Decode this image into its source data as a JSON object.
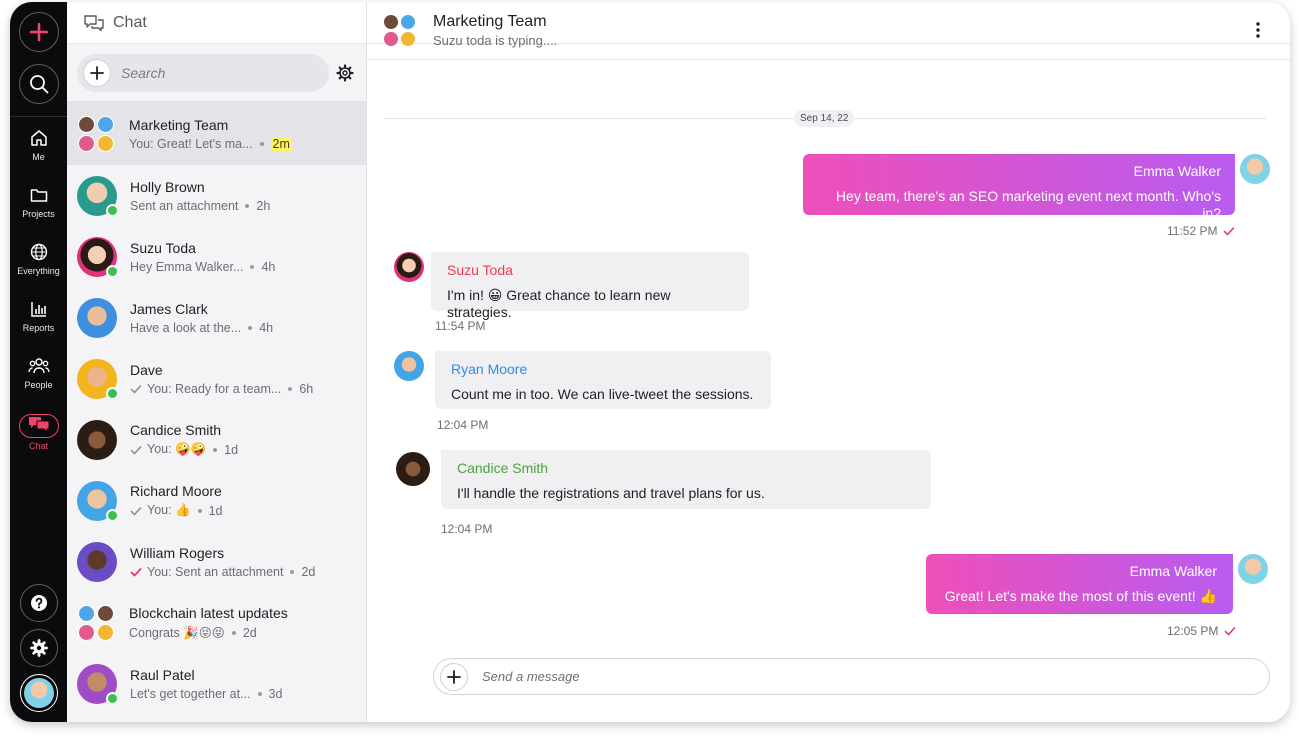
{
  "app": {
    "title": "Chat"
  },
  "rail": {
    "items": [
      {
        "label": "Me",
        "icon": "home-icon"
      },
      {
        "label": "Projects",
        "icon": "folder-icon"
      },
      {
        "label": "Everything",
        "icon": "globe-icon"
      },
      {
        "label": "Reports",
        "icon": "bar-chart-icon"
      },
      {
        "label": "People",
        "icon": "people-icon"
      },
      {
        "label": "Chat",
        "icon": "chat-icon",
        "active": true
      }
    ],
    "accent": "#f0446e"
  },
  "search": {
    "placeholder": "Search"
  },
  "conversations": [
    {
      "name": "Marketing Team",
      "preview": "You: Great! Let's ma...",
      "time": "2m",
      "group": true,
      "active": true
    },
    {
      "name": "Holly Brown",
      "preview": "Sent an attachment",
      "time": "2h",
      "online": true
    },
    {
      "name": "Suzu Toda",
      "preview": "Hey Emma Walker...",
      "time": "4h",
      "online": true
    },
    {
      "name": "James Clark",
      "preview": "Have a look at the...",
      "time": "4h"
    },
    {
      "name": "Dave",
      "preview": "You: Ready for a team...",
      "time": "6h",
      "online": true,
      "check": "grey"
    },
    {
      "name": "Candice Smith",
      "preview": "You: 🤪🤪",
      "time": "1d",
      "check": "grey"
    },
    {
      "name": "Richard Moore",
      "preview": "You: 👍",
      "time": "1d",
      "online": true,
      "check": "grey"
    },
    {
      "name": "William Rogers",
      "preview": "You: Sent an attachment",
      "time": "2d",
      "check": "pink"
    },
    {
      "name": "Blockchain latest updates",
      "preview": "Congrats 🎉😝😝",
      "time": "2d",
      "group": true
    },
    {
      "name": "Raul Patel",
      "preview": "Let's get together at...",
      "time": "3d",
      "online": true
    }
  ],
  "chat": {
    "title": "Marketing Team",
    "status": "Suzu toda is typing....",
    "date_divider": "Sep 14, 22",
    "messages": [
      {
        "author": "Emma Walker",
        "text": "Hey team, there's an SEO marketing event next month. Who's in?",
        "time": "11:52 PM",
        "outgoing": true
      },
      {
        "author": "Suzu Toda",
        "text": "I'm in! 😀 Great chance to learn new strategies.",
        "time": "11:54 PM",
        "color": "#ef3b4f"
      },
      {
        "author": "Ryan Moore",
        "text": "Count me in too. We can live-tweet the sessions.",
        "time": "12:04 PM",
        "color": "#2a8ee8"
      },
      {
        "author": "Candice Smith",
        "text": "I'll handle the registrations and travel plans for us.",
        "time": "12:04 PM",
        "color": "#4aa33b"
      },
      {
        "author": "Emma Walker",
        "text": "Great! Let's make the most of this event! 👍",
        "time": "12:05 PM",
        "outgoing": true
      }
    ],
    "composer_placeholder": "Send a message"
  }
}
